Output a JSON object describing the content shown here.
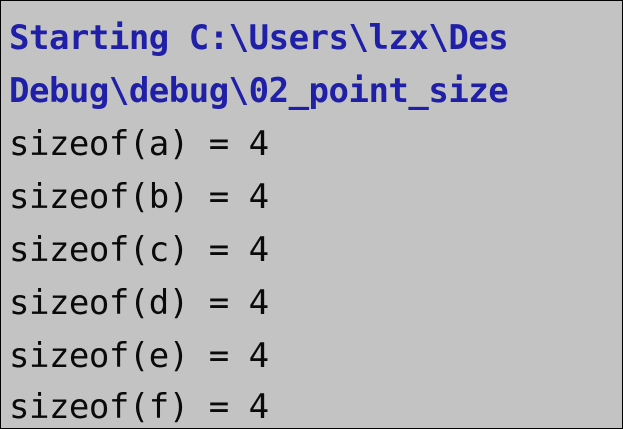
{
  "console": {
    "header_lines": [
      "Starting C:\\Users\\lzx\\Des",
      "Debug\\debug\\02_point_size"
    ],
    "output_lines": [
      "sizeof(a) = 4",
      "sizeof(b) = 4",
      "sizeof(c) = 4",
      "sizeof(d) = 4",
      "sizeof(e) = 4",
      "sizeof(f) = 4"
    ]
  },
  "colors": {
    "background": "#c3c3c3",
    "header_text": "#1f1fa8",
    "output_text": "#0a0a0a",
    "border": "#000000"
  }
}
